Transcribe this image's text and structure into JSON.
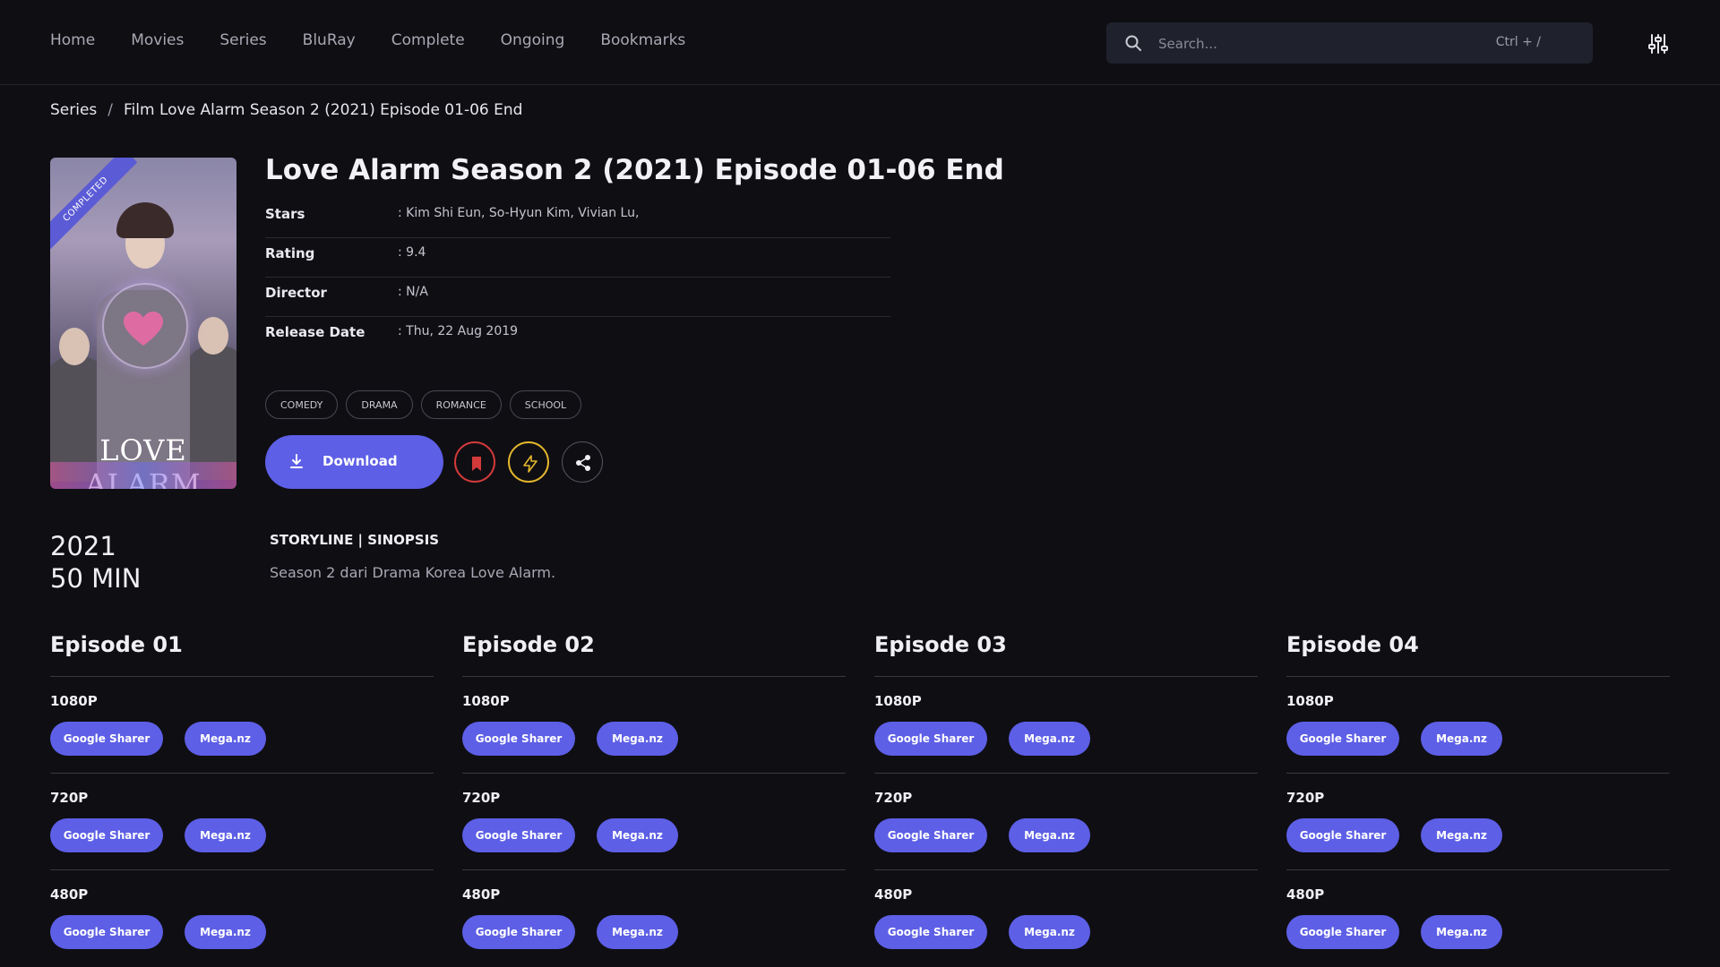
{
  "nav": {
    "items": [
      "Home",
      "Movies",
      "Series",
      "BluRay",
      "Complete",
      "Ongoing",
      "Bookmarks"
    ],
    "search_placeholder": "Search...",
    "search_shortcut": "Ctrl + /"
  },
  "breadcrumb": {
    "root": "Series",
    "separator": "/",
    "current": "Film Love Alarm Season 2 (2021) Episode 01-06 End"
  },
  "poster": {
    "badge": "COMPLETED",
    "title_art": "LOVE ALARM"
  },
  "movie": {
    "title": "Love Alarm Season 2 (2021) Episode 01-06 End",
    "info": [
      {
        "key": "Stars",
        "value": ": Kim Shi Eun, So-Hyun Kim, Vivian Lu,"
      },
      {
        "key": "Rating",
        "value": ": 9.4"
      },
      {
        "key": "Director",
        "value": ": N/A"
      },
      {
        "key": "Release Date",
        "value": ": Thu, 22 Aug 2019"
      }
    ],
    "genres": [
      "COMEDY",
      "DRAMA",
      "ROMANCE",
      "SCHOOL"
    ],
    "download_label": "Download",
    "year": "2021",
    "duration": "50 MIN",
    "storyline_heading": "STORYLINE | SINOPSIS",
    "storyline": "Season 2 dari Drama Korea Love Alarm."
  },
  "episodes": [
    {
      "title": "Episode 01",
      "resolutions": [
        {
          "label": "1080P",
          "links": [
            "Google Sharer",
            "Mega.nz"
          ]
        },
        {
          "label": "720P",
          "links": [
            "Google Sharer",
            "Mega.nz"
          ]
        },
        {
          "label": "480P",
          "links": [
            "Google Sharer",
            "Mega.nz"
          ]
        }
      ]
    },
    {
      "title": "Episode 02",
      "resolutions": [
        {
          "label": "1080P",
          "links": [
            "Google Sharer",
            "Mega.nz"
          ]
        },
        {
          "label": "720P",
          "links": [
            "Google Sharer",
            "Mega.nz"
          ]
        },
        {
          "label": "480P",
          "links": [
            "Google Sharer",
            "Mega.nz"
          ]
        }
      ]
    },
    {
      "title": "Episode 03",
      "resolutions": [
        {
          "label": "1080P",
          "links": [
            "Google Sharer",
            "Mega.nz"
          ]
        },
        {
          "label": "720P",
          "links": [
            "Google Sharer",
            "Mega.nz"
          ]
        },
        {
          "label": "480P",
          "links": [
            "Google Sharer",
            "Mega.nz"
          ]
        }
      ]
    },
    {
      "title": "Episode 04",
      "resolutions": [
        {
          "label": "1080P",
          "links": [
            "Google Sharer",
            "Mega.nz"
          ]
        },
        {
          "label": "720P",
          "links": [
            "Google Sharer",
            "Mega.nz"
          ]
        },
        {
          "label": "480P",
          "links": [
            "Google Sharer",
            "Mega.nz"
          ]
        }
      ]
    }
  ],
  "colors": {
    "background": "#0f0e13",
    "accent": "#5d5fe6",
    "bookmark": "#d33a3a",
    "bolt": "#e3b62c"
  }
}
